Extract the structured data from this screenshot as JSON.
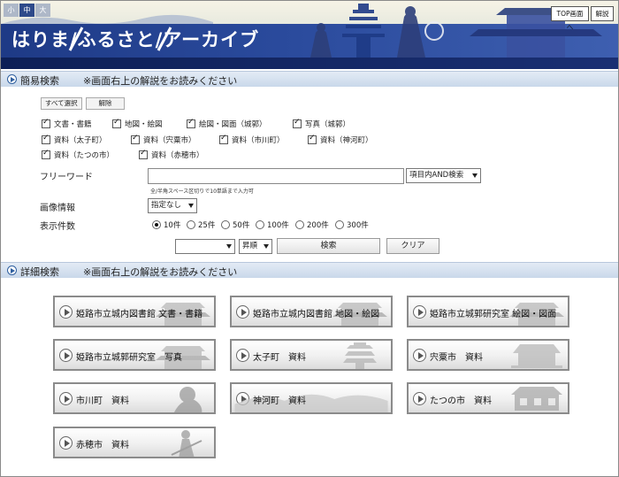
{
  "header": {
    "size_small": "小",
    "size_medium": "中",
    "size_large": "大",
    "title": "はりま/ふるさと/アーカイブ",
    "top_link": "TOP画面へ",
    "help_link": "解説"
  },
  "simple_search": {
    "heading": "簡易検索",
    "note": "※画面右上の解説をお読みください",
    "select_all": "すべて選択",
    "clear_selection": "解除",
    "categories": [
      {
        "label": "文書・書籍",
        "checked": true
      },
      {
        "label": "地図・絵図",
        "checked": true
      },
      {
        "label": "絵図・図面（城郭）",
        "checked": true
      },
      {
        "label": "写真（城郭）",
        "checked": true
      },
      {
        "label": "資料（太子町）",
        "checked": true
      },
      {
        "label": "資料（宍粟市）",
        "checked": true
      },
      {
        "label": "資料（市川町）",
        "checked": true
      },
      {
        "label": "資料（神河町）",
        "checked": true
      },
      {
        "label": "資料（たつの市）",
        "checked": true
      },
      {
        "label": "資料（赤穂市）",
        "checked": true
      }
    ],
    "freeword_label": "フリーワード",
    "freeword_value": "",
    "match_mode": "項目内AND検索",
    "freeword_hint": "全/半角スペース区切りで10単語まで入力可",
    "image_label": "画像情報",
    "image_value": "指定なし",
    "count_label": "表示件数",
    "count_options": [
      "10件",
      "25件",
      "50件",
      "100件",
      "200件",
      "300件"
    ],
    "count_selected": "10件",
    "sort_field": "",
    "sort_order": "昇順",
    "search_button": "検索",
    "clear_button": "クリア"
  },
  "detail_search": {
    "heading": "詳細検索",
    "note": "※画面右上の解説をお読みください",
    "tiles": [
      {
        "label": "姫路市立城内図書館 文書・書籍",
        "art": "castle-gate"
      },
      {
        "label": "姫路市立城内図書館 地図・絵図",
        "art": "castle-gate"
      },
      {
        "label": "姫路市立城郭研究室 絵図・図面",
        "art": "castle-gate"
      },
      {
        "label": "姫路市立城郭研究室　写真",
        "art": "castle-gate"
      },
      {
        "label": "太子町　資料",
        "art": "pagoda"
      },
      {
        "label": "宍粟市　資料",
        "art": "shrine"
      },
      {
        "label": "市川町　資料",
        "art": "figure"
      },
      {
        "label": "神河町　資料",
        "art": "mountains"
      },
      {
        "label": "たつの市　資料",
        "art": "house"
      },
      {
        "label": "赤穂市　資料",
        "art": "samurai"
      }
    ]
  },
  "colors": {
    "banner_band": "#2a4a9c",
    "section_bar": "#d5e1ef",
    "accent": "#2f5f9f"
  }
}
